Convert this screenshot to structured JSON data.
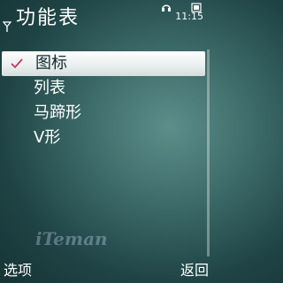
{
  "header": {
    "title": "功能表",
    "time": "11:15",
    "icons": [
      "signal-icon",
      "headset-icon",
      "battery-icon"
    ]
  },
  "menu": {
    "items": [
      {
        "label": "图标",
        "checked": true
      },
      {
        "label": "列表",
        "checked": false
      },
      {
        "label": "马蹄形",
        "checked": false
      },
      {
        "label": "V形",
        "checked": false
      }
    ]
  },
  "watermark": "iTeman",
  "softkeys": {
    "left": "选项",
    "right": "返回"
  },
  "colors": {
    "background": "#2e5857",
    "selection": "#ffffff",
    "check": "#c4365a"
  }
}
